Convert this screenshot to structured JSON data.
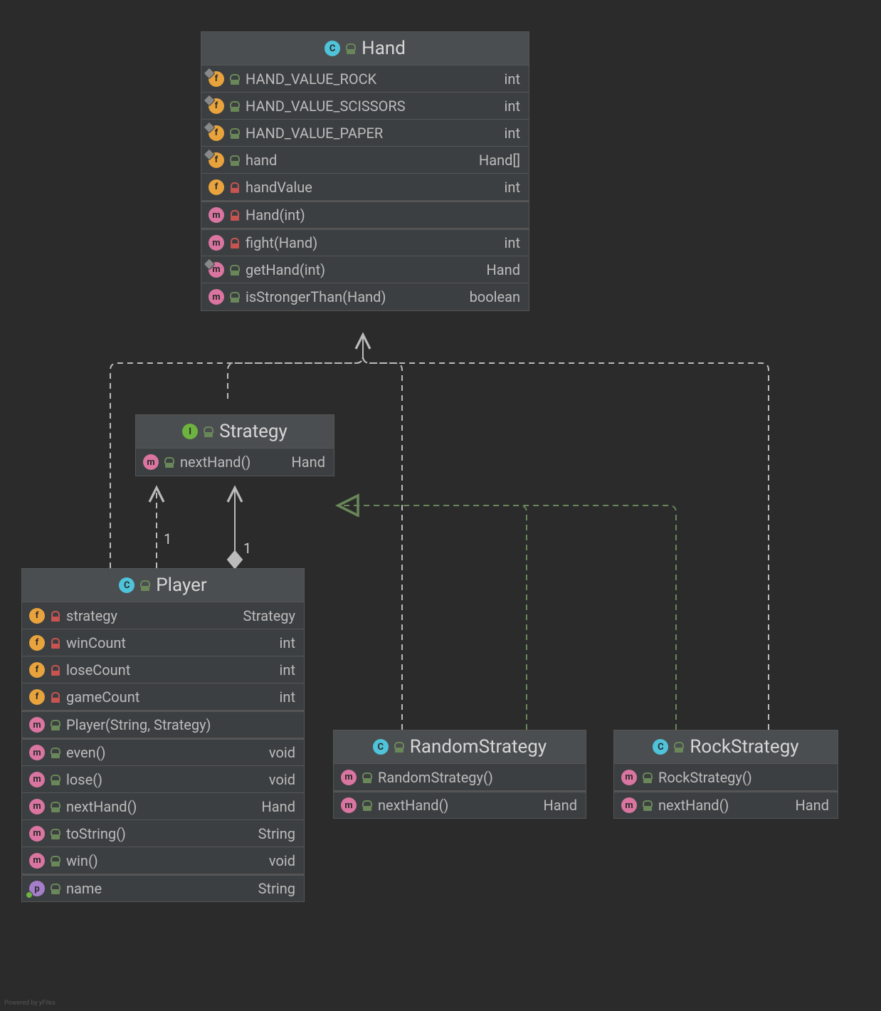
{
  "footer": "Powered by yFiles",
  "mult": {
    "a": "1",
    "b": "1"
  },
  "classes": {
    "hand": {
      "name": "Hand",
      "kind": "class",
      "members": [
        {
          "icon": "f",
          "static": true,
          "vis": "public",
          "name": "HAND_VALUE_ROCK",
          "type": "int",
          "section": 0
        },
        {
          "icon": "f",
          "static": true,
          "vis": "public",
          "name": "HAND_VALUE_SCISSORS",
          "type": "int",
          "section": 0
        },
        {
          "icon": "f",
          "static": true,
          "vis": "public",
          "name": "HAND_VALUE_PAPER",
          "type": "int",
          "section": 0
        },
        {
          "icon": "f",
          "static": true,
          "vis": "public",
          "name": "hand",
          "type": "Hand[]",
          "section": 0
        },
        {
          "icon": "f",
          "static": false,
          "vis": "private",
          "name": "handValue",
          "type": "int",
          "section": 0
        },
        {
          "icon": "m",
          "static": false,
          "vis": "private",
          "name": "Hand(int)",
          "type": "",
          "section": 1
        },
        {
          "icon": "m",
          "static": false,
          "vis": "private",
          "name": "fight(Hand)",
          "type": "int",
          "section": 2
        },
        {
          "icon": "m",
          "static": true,
          "vis": "public",
          "name": "getHand(int)",
          "type": "Hand",
          "section": 2
        },
        {
          "icon": "m",
          "static": false,
          "vis": "public",
          "name": "isStrongerThan(Hand)",
          "type": "boolean",
          "section": 2
        }
      ]
    },
    "strategy": {
      "name": "Strategy",
      "kind": "interface",
      "members": [
        {
          "icon": "m",
          "abstract": true,
          "vis": "public",
          "name": "nextHand()",
          "type": "Hand",
          "section": 0
        }
      ]
    },
    "player": {
      "name": "Player",
      "kind": "class",
      "members": [
        {
          "icon": "f",
          "vis": "private",
          "name": "strategy",
          "type": "Strategy",
          "section": 0
        },
        {
          "icon": "f",
          "vis": "private",
          "name": "winCount",
          "type": "int",
          "section": 0
        },
        {
          "icon": "f",
          "vis": "private",
          "name": "loseCount",
          "type": "int",
          "section": 0
        },
        {
          "icon": "f",
          "vis": "private",
          "name": "gameCount",
          "type": "int",
          "section": 0
        },
        {
          "icon": "m",
          "vis": "public",
          "name": "Player(String, Strategy)",
          "type": "",
          "section": 1
        },
        {
          "icon": "m",
          "vis": "public",
          "name": "even()",
          "type": "void",
          "section": 2
        },
        {
          "icon": "m",
          "vis": "public",
          "name": "lose()",
          "type": "void",
          "section": 2
        },
        {
          "icon": "m",
          "vis": "public",
          "name": "nextHand()",
          "type": "Hand",
          "section": 2
        },
        {
          "icon": "m",
          "vis": "public",
          "name": "toString()",
          "type": "String",
          "section": 2
        },
        {
          "icon": "m",
          "vis": "public",
          "name": "win()",
          "type": "void",
          "section": 2
        },
        {
          "icon": "p",
          "vis": "public",
          "name": "name",
          "type": "String",
          "section": 3,
          "sub": "green"
        }
      ]
    },
    "random": {
      "name": "RandomStrategy",
      "kind": "class",
      "members": [
        {
          "icon": "m",
          "vis": "public",
          "name": "RandomStrategy()",
          "type": "",
          "section": 0
        },
        {
          "icon": "m",
          "vis": "public",
          "name": "nextHand()",
          "type": "Hand",
          "section": 1
        }
      ]
    },
    "rock": {
      "name": "RockStrategy",
      "kind": "class",
      "members": [
        {
          "icon": "m",
          "vis": "public",
          "name": "RockStrategy()",
          "type": "",
          "section": 0
        },
        {
          "icon": "m",
          "vis": "public",
          "name": "nextHand()",
          "type": "Hand",
          "section": 1
        }
      ]
    }
  }
}
